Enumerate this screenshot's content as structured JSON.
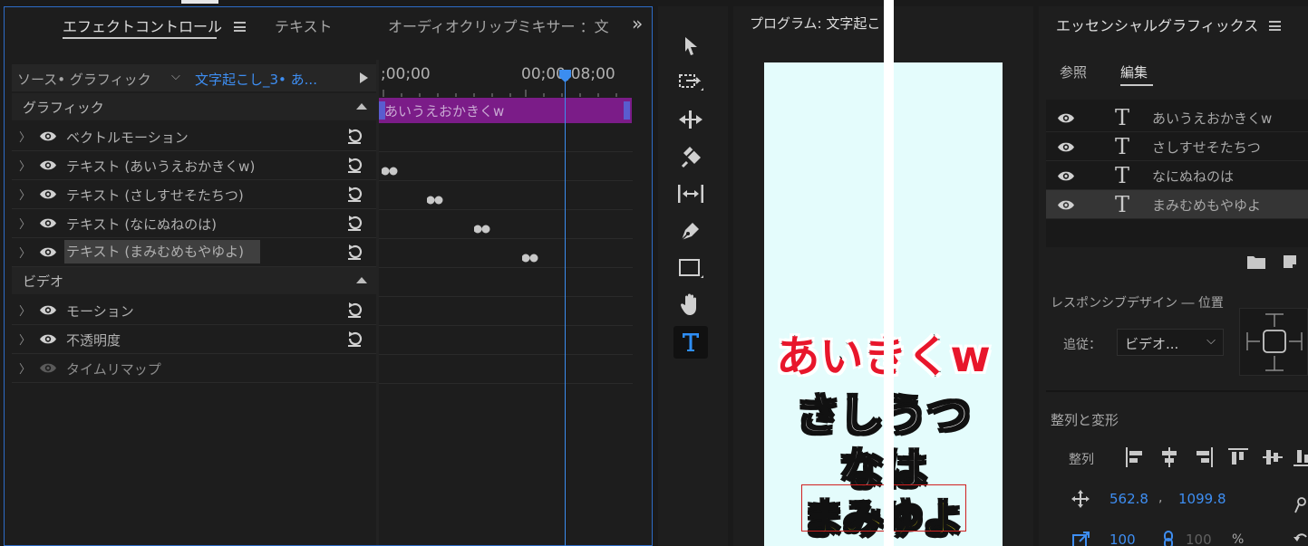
{
  "effect_controls": {
    "tabs": [
      {
        "label": "エフェクトコントロール",
        "active": true
      },
      {
        "label": "テキスト",
        "active": false
      },
      {
        "label": "オーディオクリップミキサー ：文",
        "active": false
      }
    ],
    "overflow_label": "»",
    "source_label": "ソース• グラフィック",
    "clip_label": "文字起こし_3• あ...",
    "sections": [
      {
        "title": "グラフィック",
        "properties": [
          {
            "label": "ベクトルモーション",
            "eye": true,
            "reset": true
          },
          {
            "label": "テキスト (あいうえおかきくw)",
            "eye": true,
            "reset": true
          },
          {
            "label": "テキスト (さしすせそたちつ)",
            "eye": true,
            "reset": true
          },
          {
            "label": "テキスト (なにぬねのは)",
            "eye": true,
            "reset": true
          },
          {
            "label": "テキスト (まみむめもやゆよ)",
            "eye": true,
            "reset": true,
            "selected": true
          }
        ]
      },
      {
        "title": "ビデオ",
        "properties": [
          {
            "label": "モーション",
            "eye": true,
            "reset": true
          },
          {
            "label": "不透明度",
            "eye": true,
            "reset": true
          },
          {
            "label": "タイムリマップ",
            "eye": false,
            "reset": false
          }
        ]
      }
    ],
    "timeline": {
      "start_time": ";00;00",
      "end_time": "00;00;08;00",
      "clip_name": "あいうえおかきくw"
    }
  },
  "tools": {
    "items": [
      "selection-tool",
      "track-select-tool",
      "ripple-edit-tool",
      "razor-tool",
      "slip-tool",
      "pen-tool",
      "rectangle-tool",
      "hand-tool",
      "type-tool"
    ],
    "active": "type-tool"
  },
  "program": {
    "title": "プログラム: 文字起こ",
    "captions": [
      "あいきくw",
      "さしうつ",
      "なは",
      "まみゆよ"
    ],
    "colors": {
      "canvas": "#e4fcfc",
      "caption1": "#e8162b",
      "caption4": "#fff21a"
    }
  },
  "essential_graphics": {
    "title": "エッセンシャルグラフィックス",
    "tabs": [
      {
        "label": "参照",
        "active": false
      },
      {
        "label": "編集",
        "active": true
      }
    ],
    "layers": [
      {
        "name": "あいうえおかきくw",
        "selected": false
      },
      {
        "name": "さしすせそたちつ",
        "selected": false
      },
      {
        "name": "なにぬねのは",
        "selected": false
      },
      {
        "name": "まみむめもやゆよ",
        "selected": true
      }
    ],
    "responsive_label": "レスポンシブデザイン ― 位置",
    "follow_label": "追従：",
    "follow_value": "ビデオ...",
    "align_section": "整列と変形",
    "align_label": "整列",
    "position_x": "562.8",
    "position_sep": ",",
    "position_y": "1099.8",
    "scale_value": "100",
    "scale_link_value": "100",
    "scale_unit": "%"
  },
  "colors": {
    "accent": "#3e8ef2",
    "clip": "#7b1c88",
    "panel_focus": "#2d6cc7"
  }
}
